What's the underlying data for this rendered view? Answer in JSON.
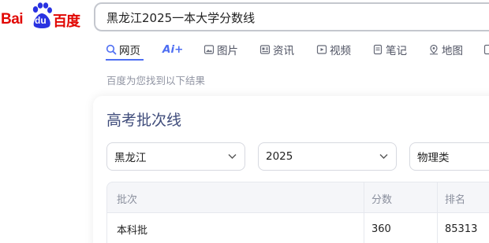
{
  "logo": {
    "latin": "Bai",
    "paw_text": "du",
    "chinese": "百度"
  },
  "search": {
    "query": "黑龙江2025一本大学分数线"
  },
  "tabs": [
    {
      "label": "网页",
      "icon": "search-icon",
      "active": true
    },
    {
      "label": "Ai+",
      "icon": "ai-sparkle-icon",
      "active": false
    },
    {
      "label": "图片",
      "icon": "image-icon",
      "active": false
    },
    {
      "label": "资讯",
      "icon": "news-icon",
      "active": false
    },
    {
      "label": "视频",
      "icon": "video-icon",
      "active": false
    },
    {
      "label": "笔记",
      "icon": "note-icon",
      "active": false
    },
    {
      "label": "地图",
      "icon": "map-pin-icon",
      "active": false
    }
  ],
  "result_hint": "百度为您找到以下结果",
  "card": {
    "title": "高考批次线",
    "filters": {
      "province": "黑龙江",
      "year": "2025",
      "subject": "物理类"
    },
    "table": {
      "headers": [
        "批次",
        "分数",
        "排名"
      ],
      "rows": [
        [
          "本科批",
          "360",
          "85313"
        ]
      ]
    }
  },
  "colors": {
    "brand_red": "#e10602",
    "brand_blue": "#2932e1",
    "accent_blue": "#4e6ef2",
    "title_blue": "#3e4b7a"
  }
}
